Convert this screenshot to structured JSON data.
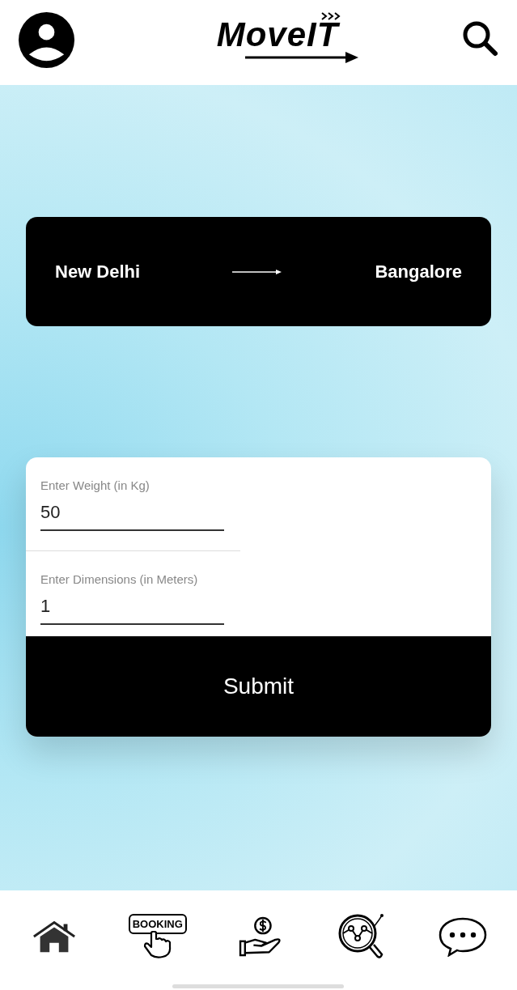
{
  "header": {
    "logo": "MoveIT"
  },
  "route": {
    "from": "New Delhi",
    "to": "Bangalore"
  },
  "form": {
    "fields": [
      {
        "label": "Enter Weight (in Kg)",
        "value": "50"
      },
      {
        "label": "Enter Dimensions (in Meters)",
        "value": "1"
      }
    ],
    "submit": "Submit"
  },
  "nav": [
    {
      "kind": "home"
    },
    {
      "kind": "booking",
      "label": "BOOKING"
    },
    {
      "kind": "payment"
    },
    {
      "kind": "tracking"
    },
    {
      "kind": "chat"
    }
  ]
}
